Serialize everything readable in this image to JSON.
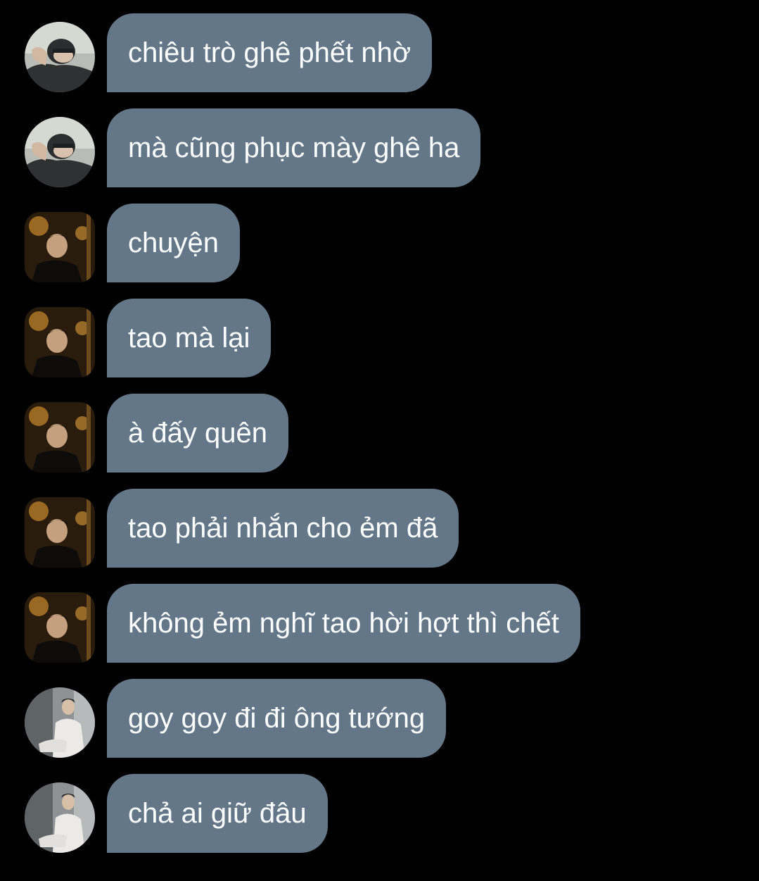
{
  "colors": {
    "background": "#000000",
    "bubble": "#647789",
    "bubble_text": "#ffffff"
  },
  "messages": [
    {
      "text": "chiêu trò ghê phết nhờ",
      "avatar": "avatar-hood-person",
      "avatar_shape": "round"
    },
    {
      "text": "mà cũng phục mày ghê ha",
      "avatar": "avatar-hood-person",
      "avatar_shape": "round"
    },
    {
      "text": "chuyện",
      "avatar": "avatar-night-street-person",
      "avatar_shape": "squircle"
    },
    {
      "text": "tao mà lại",
      "avatar": "avatar-night-street-person",
      "avatar_shape": "squircle"
    },
    {
      "text": "à đấy quên",
      "avatar": "avatar-night-street-person",
      "avatar_shape": "squircle"
    },
    {
      "text": "tao phải nhắn cho ẻm đã",
      "avatar": "avatar-night-street-person",
      "avatar_shape": "squircle"
    },
    {
      "text": "không ẻm nghĩ tao hời hợt thì chết",
      "avatar": "avatar-night-street-person",
      "avatar_shape": "squircle"
    },
    {
      "text": "goy goy đi đi ông tướng",
      "avatar": "avatar-seated-person-white-shirt",
      "avatar_shape": "round"
    },
    {
      "text": "chả ai giữ đâu",
      "avatar": "avatar-seated-person-white-shirt",
      "avatar_shape": "round"
    }
  ]
}
